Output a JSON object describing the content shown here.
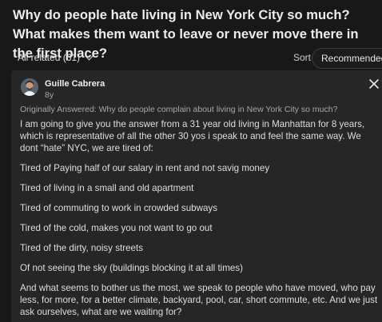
{
  "question": {
    "title": "Why do people hate living in New York City so much? What makes them want to leave or never move there in the first place?"
  },
  "related": {
    "label": "All related (61)",
    "sort_label": "Sort",
    "sort_value": "Recommended"
  },
  "answer": {
    "author": "Guille Cabrera",
    "age": "8y",
    "originally_answered": "Originally Answered: Why do people complain about living in New York City so much?",
    "paragraphs": [
      "I am going to give you the answer from a 31 year old living in Manhattan for 8 years, which is representative of all the other 30 yos i speak to and feel the same way. We dont “hate” NYC, we are tired of:",
      "Tired of Paying half of our salary in rent and not savig money",
      "Tired of living in a small and old apartment",
      "Tired of commuting to work in crowded subways",
      "Tired of the cold, makes you not want to go out",
      "Tired of the dirty, noisy streets",
      "Of not seeing the sky (buildings blocking it at all times)",
      "And what seems to bother us the most, we speak to people who have moved, who pay less, for more, for a better climate, backyard, pool, car, short commute, etc. And we just ask ourselves, what are we waiting for?"
    ]
  },
  "icons": {
    "related_chevron": "chevron-down-icon",
    "sort_chevron": "chevron-down-icon",
    "close": "close-icon",
    "avatar": "avatar"
  },
  "colors": {
    "background": "#181818",
    "card": "#262626",
    "text": "#dedede",
    "muted": "#a7a7a7"
  }
}
